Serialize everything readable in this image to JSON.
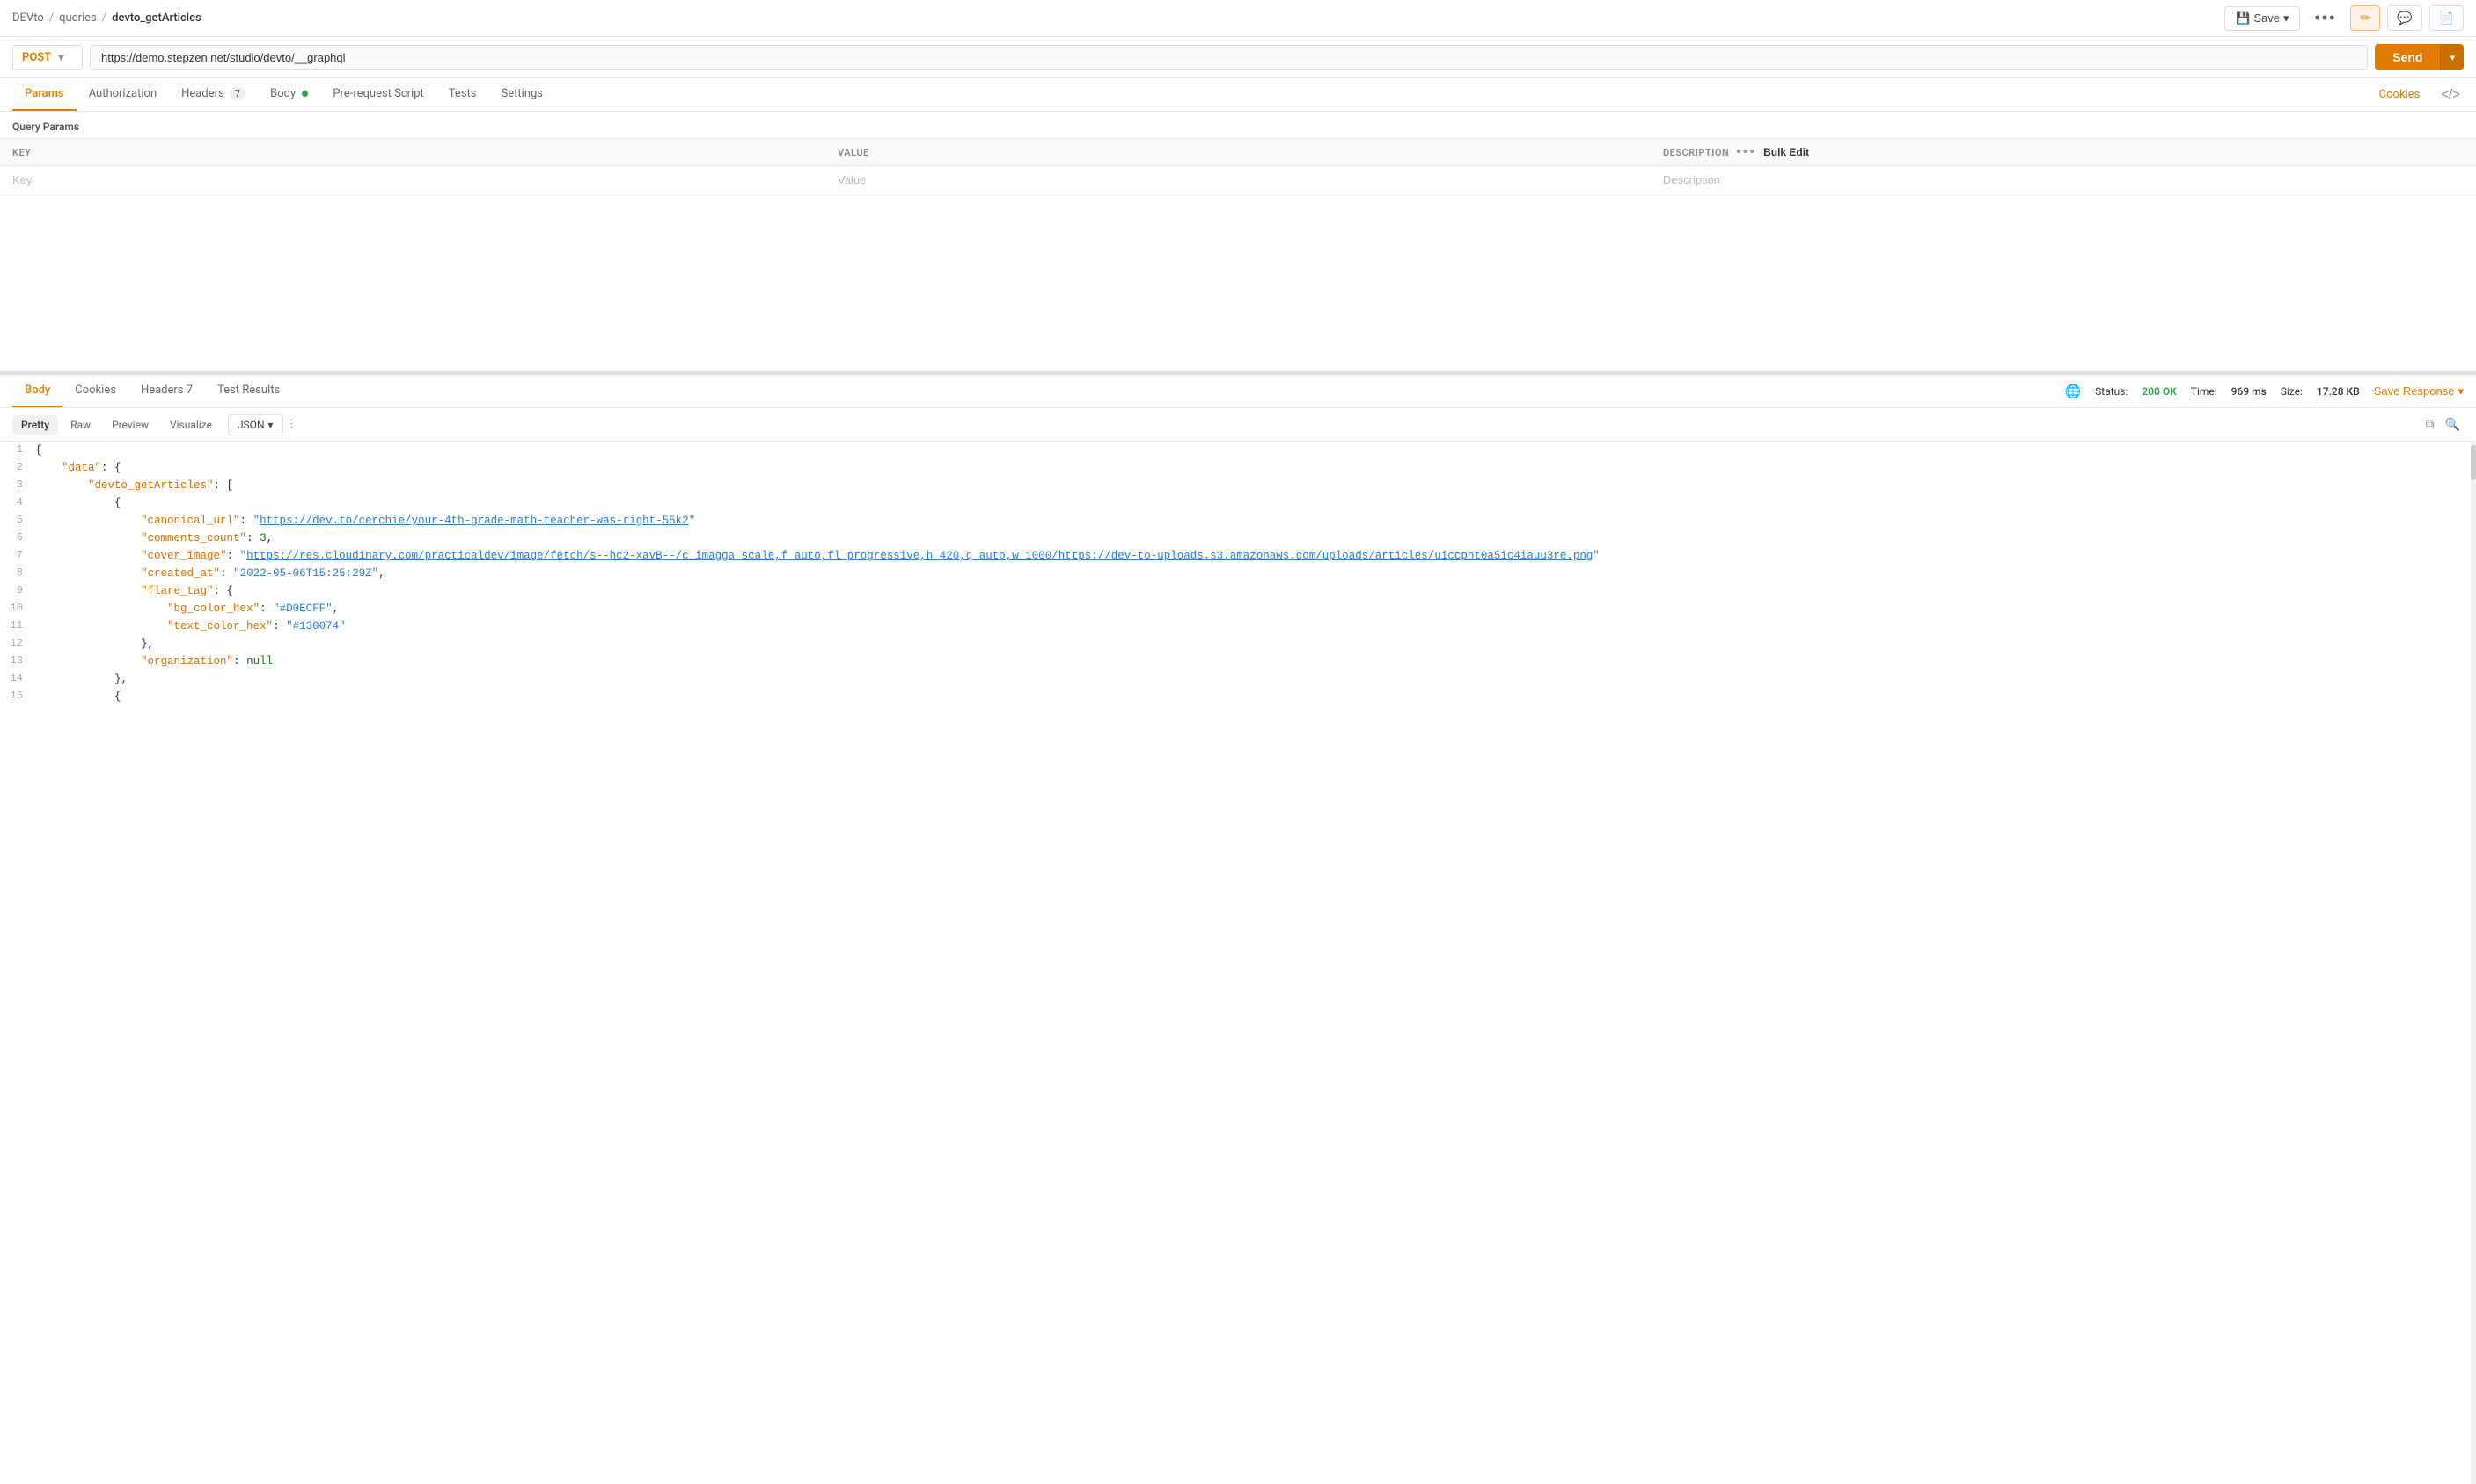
{
  "breadcrumb": {
    "parts": [
      "DEVto",
      "queries",
      "devto_getArticles"
    ],
    "separators": [
      "/",
      "/"
    ]
  },
  "top_bar": {
    "save_label": "Save",
    "more_label": "•••",
    "pencil_icon": "✏",
    "chat_icon": "☐",
    "doc_icon": "☐"
  },
  "url_bar": {
    "method": "POST",
    "url": "https://demo.stepzen.net/studio/devto/__graphql",
    "send_label": "Send"
  },
  "request_tabs": {
    "tabs": [
      {
        "label": "Params",
        "active": true
      },
      {
        "label": "Authorization"
      },
      {
        "label": "Headers",
        "badge": "7"
      },
      {
        "label": "Body",
        "dot": true
      },
      {
        "label": "Pre-request Script"
      },
      {
        "label": "Tests"
      },
      {
        "label": "Settings"
      }
    ],
    "cookies_label": "Cookies"
  },
  "params": {
    "section_label": "Query Params",
    "columns": [
      "KEY",
      "VALUE",
      "DESCRIPTION"
    ],
    "bulk_edit": "Bulk Edit",
    "placeholder_key": "Key",
    "placeholder_value": "Value",
    "placeholder_desc": "Description"
  },
  "response_tabs": {
    "tabs": [
      {
        "label": "Body",
        "active": true
      },
      {
        "label": "Cookies"
      },
      {
        "label": "Headers",
        "badge": "7"
      },
      {
        "label": "Test Results"
      }
    ],
    "status": {
      "label": "Status:",
      "value": "200 OK",
      "time_label": "Time:",
      "time_value": "969 ms",
      "size_label": "Size:",
      "size_value": "17.28 KB"
    },
    "save_response": "Save Response"
  },
  "code_format": {
    "tabs": [
      "Pretty",
      "Raw",
      "Preview",
      "Visualize"
    ],
    "active": "Pretty",
    "format": "JSON",
    "copy_icon": "⧉",
    "search_icon": "🔍",
    "filter_icon": "≡"
  },
  "code": {
    "lines": [
      {
        "num": 1,
        "tokens": [
          {
            "type": "brace",
            "text": "{"
          }
        ]
      },
      {
        "num": 2,
        "tokens": [
          {
            "type": "indent",
            "text": "    "
          },
          {
            "type": "key",
            "text": "\"data\""
          },
          {
            "type": "punct",
            "text": ": {"
          }
        ]
      },
      {
        "num": 3,
        "tokens": [
          {
            "type": "indent",
            "text": "        "
          },
          {
            "type": "key",
            "text": "\"devto_getArticles\""
          },
          {
            "type": "punct",
            "text": ": ["
          }
        ]
      },
      {
        "num": 4,
        "tokens": [
          {
            "type": "indent",
            "text": "            "
          },
          {
            "type": "brace",
            "text": "{"
          }
        ]
      },
      {
        "num": 5,
        "tokens": [
          {
            "type": "indent",
            "text": "                "
          },
          {
            "type": "key",
            "text": "\"canonical_url\""
          },
          {
            "type": "punct",
            "text": ": "
          },
          {
            "type": "str_link",
            "text": "\"https://dev.to/cerchie/your-4th-grade-math-teacher-was-right-55k2\""
          }
        ]
      },
      {
        "num": 6,
        "tokens": [
          {
            "type": "indent",
            "text": "                "
          },
          {
            "type": "key",
            "text": "\"comments_count\""
          },
          {
            "type": "punct",
            "text": ": "
          },
          {
            "type": "num",
            "text": "3"
          },
          {
            "type": "punct",
            "text": ","
          }
        ]
      },
      {
        "num": 7,
        "tokens": [
          {
            "type": "indent",
            "text": "                "
          },
          {
            "type": "key",
            "text": "\"cover_image\""
          },
          {
            "type": "punct",
            "text": ": "
          },
          {
            "type": "str_link",
            "text": "\"https://res.cloudinary.com/practicaldev/image/fetch/s--hc2-xavB--/c_imagga_scale,f_auto,fl_progressive,h_420,q_auto,w_1000/https://dev-to-uploads.s3.amazonaws.com/uploads/articles/uiccpnt0a5ic4iauu3re.png\""
          }
        ]
      },
      {
        "num": 8,
        "tokens": [
          {
            "type": "indent",
            "text": "                "
          },
          {
            "type": "key",
            "text": "\"created_at\""
          },
          {
            "type": "punct",
            "text": ": "
          },
          {
            "type": "str",
            "text": "\"2022-05-06T15:25:29Z\""
          },
          {
            "type": "punct",
            "text": ","
          }
        ]
      },
      {
        "num": 9,
        "tokens": [
          {
            "type": "indent",
            "text": "                "
          },
          {
            "type": "key",
            "text": "\"flare_tag\""
          },
          {
            "type": "punct",
            "text": ": {"
          }
        ]
      },
      {
        "num": 10,
        "tokens": [
          {
            "type": "indent",
            "text": "                    "
          },
          {
            "type": "key",
            "text": "\"bg_color_hex\""
          },
          {
            "type": "punct",
            "text": ": "
          },
          {
            "type": "str",
            "text": "\"#D0ECFF\""
          },
          {
            "type": "punct",
            "text": ","
          }
        ]
      },
      {
        "num": 11,
        "tokens": [
          {
            "type": "indent",
            "text": "                    "
          },
          {
            "type": "key",
            "text": "\"text_color_hex\""
          },
          {
            "type": "punct",
            "text": ": "
          },
          {
            "type": "str",
            "text": "\"#130074\""
          }
        ]
      },
      {
        "num": 12,
        "tokens": [
          {
            "type": "indent",
            "text": "                "
          },
          {
            "type": "brace",
            "text": "},"
          }
        ]
      },
      {
        "num": 13,
        "tokens": [
          {
            "type": "indent",
            "text": "                "
          },
          {
            "type": "key",
            "text": "\"organization\""
          },
          {
            "type": "punct",
            "text": ": "
          },
          {
            "type": "null",
            "text": "null"
          }
        ]
      },
      {
        "num": 14,
        "tokens": [
          {
            "type": "indent",
            "text": "            "
          },
          {
            "type": "brace",
            "text": "},"
          }
        ]
      },
      {
        "num": 15,
        "tokens": [
          {
            "type": "indent",
            "text": "            "
          },
          {
            "type": "brace",
            "text": "{"
          }
        ]
      }
    ]
  }
}
